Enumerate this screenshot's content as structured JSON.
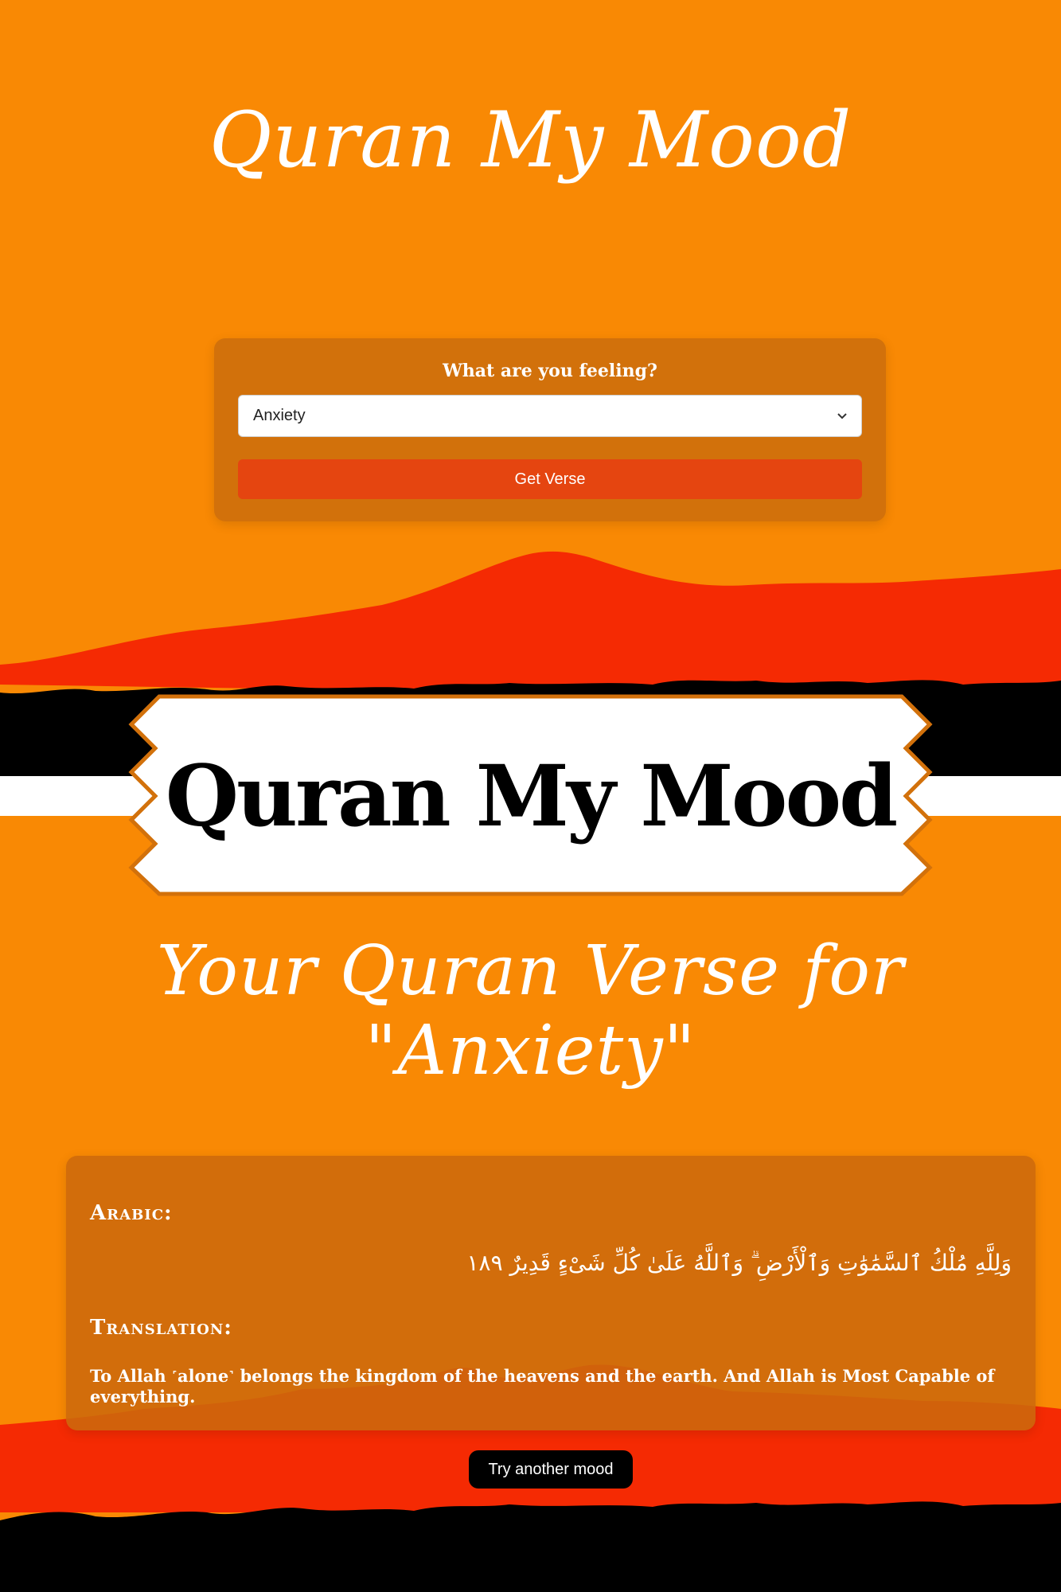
{
  "header": {
    "title": "Quran My Mood"
  },
  "mood_form": {
    "question": "What are you feeling?",
    "selected_mood": "Anxiety",
    "submit_label": "Get Verse"
  },
  "banner": {
    "title": "Quran My Mood"
  },
  "result": {
    "heading": "Your Quran Verse for \"Anxiety\"",
    "arabic_label": "Arabic:",
    "arabic_text": "وَلِلَّهِ مُلْكُ ٱلسَّمَٰوَٰتِ وَٱلْأَرْضِ ۗ وَٱللَّهُ عَلَىٰ كُلِّ شَىْءٍ قَدِيرٌ ١٨٩",
    "translation_label": "Translation:",
    "translation_text": "To Allah ˹alone˺ belongs the kingdom of the heavens and the earth. And Allah is Most Capable of everything.",
    "try_again_label": "Try another mood"
  },
  "colors": {
    "background": "#F98904",
    "card": "#D2710B",
    "button": "#E54510",
    "mountain_red": "#F52A03",
    "ridge": "#000000"
  },
  "icons": {
    "select_arrow": "chevron-down-icon"
  }
}
